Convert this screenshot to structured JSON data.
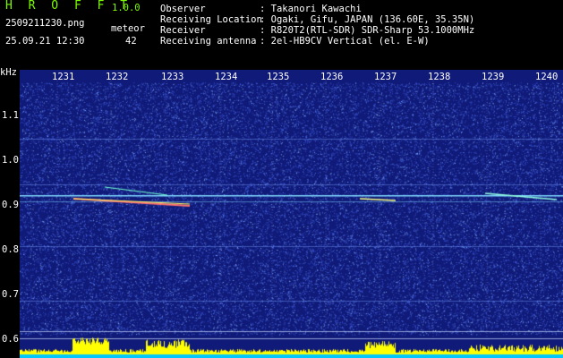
{
  "app": {
    "name": "H R O F F T",
    "version": "1.0.0"
  },
  "file": {
    "name": "2509211230.png",
    "datetime": "25.09.21 12:30"
  },
  "counter": {
    "label": "meteor",
    "value": "42"
  },
  "info": [
    {
      "key": "Observer",
      "value": ": Takanori Kawachi"
    },
    {
      "key": "Receiving Location",
      "value": ": Ogaki, Gifu, JAPAN (136.60E, 35.35N)"
    },
    {
      "key": "Receiver",
      "value": ": R820T2(RTL-SDR) SDR-Sharp 53.1000MHz"
    },
    {
      "key": "Receiving antenna",
      "value": ": 2el-HB9CV Vertical (el. E-W)"
    }
  ],
  "spectrogram": {
    "unit": "kHz",
    "time_ticks": [
      "1231",
      "1232",
      "1233",
      "1234",
      "1235",
      "1236",
      "1237",
      "1238",
      "1239",
      "1240"
    ],
    "freq_ticks": [
      "1.1",
      "1.0",
      "0.9",
      "0.8",
      "0.7",
      "0.6"
    ],
    "background_color": "#1a2aa0",
    "carrier_color": "#7fd8ff",
    "histogram_color": "#ffff00",
    "baseline_color": "#00c8ff"
  }
}
